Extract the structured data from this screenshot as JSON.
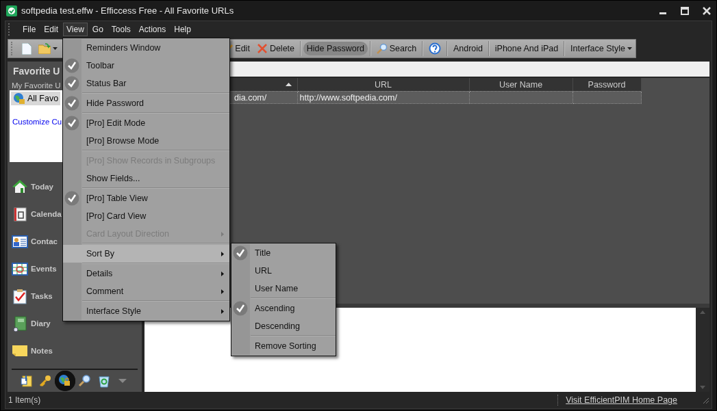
{
  "window": {
    "title": "softpedia test.effw - Efficcess Free - All Favorite URLs"
  },
  "menu_bar": [
    {
      "label": "File",
      "selected": false
    },
    {
      "label": "Edit",
      "selected": false
    },
    {
      "label": "View",
      "selected": true
    },
    {
      "label": "Go",
      "selected": false
    },
    {
      "label": "Tools",
      "selected": false
    },
    {
      "label": "Actions",
      "selected": false
    },
    {
      "label": "Help",
      "selected": false
    }
  ],
  "toolbar": [
    {
      "kind": "edit",
      "label": "Edit"
    },
    {
      "kind": "delete",
      "label": "Delete"
    },
    {
      "kind": "toggle",
      "label": "Hide Password",
      "on": true
    },
    {
      "kind": "search",
      "label": "Search"
    },
    {
      "kind": "help"
    },
    {
      "kind": "text",
      "label": "Android"
    },
    {
      "kind": "text",
      "label": "iPhone And iPad"
    },
    {
      "kind": "dropdown",
      "label": "Interface Style"
    }
  ],
  "sidebar": {
    "title": "Favorite U",
    "subtitle": "My Favorite U",
    "groups": [
      {
        "label": "All Favo",
        "selected": true
      }
    ],
    "link": "Customize Cu",
    "nav": [
      {
        "kind": "today",
        "label": "Today"
      },
      {
        "kind": "calendar",
        "label": "Calenda"
      },
      {
        "kind": "contacts",
        "label": "Contac"
      },
      {
        "kind": "events",
        "label": "Events"
      },
      {
        "kind": "tasks",
        "label": "Tasks"
      },
      {
        "kind": "diary",
        "label": "Diary"
      },
      {
        "kind": "notes",
        "label": "Notes"
      }
    ],
    "shortcuts": [
      {
        "kind": "notes",
        "selected": false
      },
      {
        "kind": "key",
        "selected": false
      },
      {
        "kind": "favorites",
        "selected": true
      },
      {
        "kind": "search",
        "selected": false
      },
      {
        "kind": "recycle",
        "selected": false
      },
      {
        "kind": "more",
        "selected": false
      }
    ]
  },
  "table": {
    "columns": [
      {
        "sorted": true
      },
      {
        "label": "URL",
        "sorted": false
      },
      {
        "label": "User Name",
        "sorted": false
      },
      {
        "label": "Password",
        "sorted": false
      }
    ],
    "rows": [
      {
        "column_1": "dia.com/",
        "url": "http://www.softpedia.com/",
        "selected": true
      }
    ]
  },
  "status_bar": {
    "count": "1 Item(s)",
    "link": "Visit EfficientPIM Home Page"
  },
  "view_menu": {
    "groups": [
      [
        {
          "label": "Reminders Window",
          "checked": false,
          "disabled": false,
          "submenu": false,
          "selected": false
        },
        {
          "label": "Toolbar",
          "checked": true,
          "disabled": false,
          "submenu": false,
          "selected": false
        },
        {
          "label": "Status Bar",
          "checked": true,
          "disabled": false,
          "submenu": false,
          "selected": false
        }
      ],
      [
        {
          "label": "Hide Password",
          "checked": true,
          "disabled": false,
          "submenu": false,
          "selected": false
        }
      ],
      [
        {
          "label": "[Pro] Edit Mode",
          "checked": true,
          "disabled": false,
          "submenu": false,
          "selected": false
        },
        {
          "label": "[Pro] Browse Mode",
          "checked": false,
          "disabled": false,
          "submenu": false,
          "selected": false
        }
      ],
      [
        {
          "label": "[Pro] Show Records in Subgroups",
          "checked": false,
          "disabled": true,
          "submenu": false,
          "selected": false
        },
        {
          "label": "Show Fields...",
          "checked": false,
          "disabled": false,
          "submenu": false,
          "selected": false
        }
      ],
      [
        {
          "label": "[Pro] Table View",
          "checked": true,
          "disabled": false,
          "submenu": false,
          "selected": false
        },
        {
          "label": "[Pro] Card View",
          "checked": false,
          "disabled": false,
          "submenu": false,
          "selected": false
        },
        {
          "label": "Card Layout Direction",
          "checked": false,
          "disabled": true,
          "submenu": true,
          "selected": false
        }
      ],
      [
        {
          "label": "Sort By",
          "checked": false,
          "disabled": false,
          "submenu": true,
          "selected": true
        }
      ],
      [
        {
          "label": "Details",
          "checked": false,
          "disabled": false,
          "submenu": true,
          "selected": false
        },
        {
          "label": "Comment",
          "checked": false,
          "disabled": false,
          "submenu": true,
          "selected": false
        }
      ],
      [
        {
          "label": "Interface Style",
          "checked": false,
          "disabled": false,
          "submenu": true,
          "selected": false
        }
      ]
    ]
  },
  "sort_menu": {
    "groups": [
      [
        {
          "label": "Title",
          "checked": true,
          "disabled": false,
          "submenu": false,
          "selected": false
        },
        {
          "label": "URL",
          "checked": false,
          "disabled": false,
          "submenu": false,
          "selected": false
        },
        {
          "label": "User Name",
          "checked": false,
          "disabled": false,
          "submenu": false,
          "selected": false
        }
      ],
      [
        {
          "label": "Ascending",
          "checked": true,
          "disabled": false,
          "submenu": false,
          "selected": false
        },
        {
          "label": "Descending",
          "checked": false,
          "disabled": false,
          "submenu": false,
          "selected": false
        }
      ],
      [
        {
          "label": "Remove Sorting",
          "checked": false,
          "disabled": false,
          "submenu": false,
          "selected": false
        }
      ]
    ]
  }
}
